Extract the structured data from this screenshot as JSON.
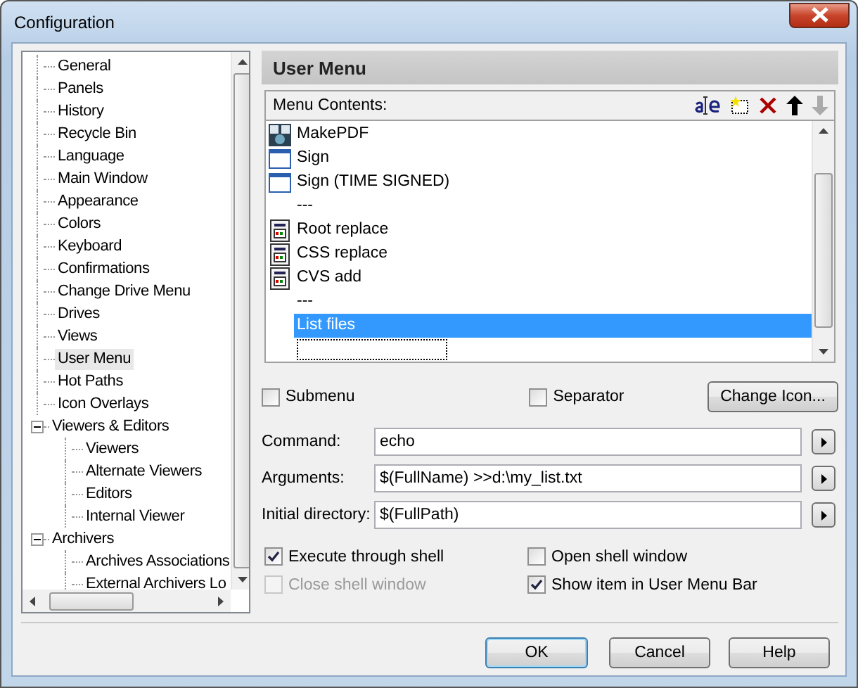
{
  "window": {
    "title": "Configuration"
  },
  "tree": [
    {
      "label": "General",
      "selected": false
    },
    {
      "label": "Panels",
      "selected": false
    },
    {
      "label": "History",
      "selected": false
    },
    {
      "label": "Recycle Bin",
      "selected": false
    },
    {
      "label": "Language",
      "selected": false
    },
    {
      "label": "Main Window",
      "selected": false
    },
    {
      "label": "Appearance",
      "selected": false
    },
    {
      "label": "Colors",
      "selected": false
    },
    {
      "label": "Keyboard",
      "selected": false
    },
    {
      "label": "Confirmations",
      "selected": false
    },
    {
      "label": "Change Drive Menu",
      "selected": false
    },
    {
      "label": "Drives",
      "selected": false
    },
    {
      "label": "Views",
      "selected": false
    },
    {
      "label": "User Menu",
      "selected": true
    },
    {
      "label": "Hot Paths",
      "selected": false
    },
    {
      "label": "Icon Overlays",
      "selected": false
    },
    {
      "label": "Viewers & Editors",
      "selected": false,
      "expanded": true,
      "children": [
        {
          "label": "Viewers",
          "selected": false
        },
        {
          "label": "Alternate Viewers",
          "selected": false
        },
        {
          "label": "Editors",
          "selected": false
        },
        {
          "label": "Internal Viewer",
          "selected": false
        }
      ]
    },
    {
      "label": "Archivers",
      "selected": false,
      "expanded": true,
      "children": [
        {
          "label": "Archives Associations",
          "selected": false
        },
        {
          "label": "External Archivers Lo",
          "selected": false
        }
      ]
    }
  ],
  "page_title": "User Menu",
  "menu_contents": {
    "label": "Menu Contents:",
    "items": [
      {
        "kind": "program",
        "label": "MakePDF",
        "selected": false
      },
      {
        "kind": "window",
        "label": "Sign",
        "selected": false
      },
      {
        "kind": "window",
        "label": "Sign (TIME SIGNED)",
        "selected": false
      },
      {
        "kind": "separator",
        "label": "---",
        "selected": false
      },
      {
        "kind": "script",
        "label": "Root replace",
        "selected": false
      },
      {
        "kind": "script",
        "label": "CSS replace",
        "selected": false
      },
      {
        "kind": "script",
        "label": "CVS add",
        "selected": false
      },
      {
        "kind": "separator",
        "label": "---",
        "selected": false
      },
      {
        "kind": "plain",
        "label": "List files",
        "selected": true
      }
    ]
  },
  "options_top": [
    {
      "label": "Submenu",
      "checked": false,
      "disabled": false
    },
    {
      "label": "Separator",
      "checked": false,
      "disabled": false
    }
  ],
  "change_icon_button": "Change Icon...",
  "fields": [
    {
      "label": "Command:",
      "value": "echo"
    },
    {
      "label": "Arguments:",
      "value": "$(FullName) >>d:\\my_list.txt"
    },
    {
      "label": "Initial directory:",
      "value": "$(FullPath)"
    }
  ],
  "options": [
    {
      "label": "Execute through shell",
      "checked": true,
      "disabled": false
    },
    {
      "label": "Open shell window",
      "checked": false,
      "disabled": false
    },
    {
      "label": "Close shell window",
      "checked": false,
      "disabled": true
    },
    {
      "label": "Show item in User Menu Bar",
      "checked": true,
      "disabled": false
    }
  ],
  "buttons": [
    {
      "label": "OK",
      "default": true
    },
    {
      "label": "Cancel",
      "default": false
    },
    {
      "label": "Help",
      "default": false
    }
  ]
}
